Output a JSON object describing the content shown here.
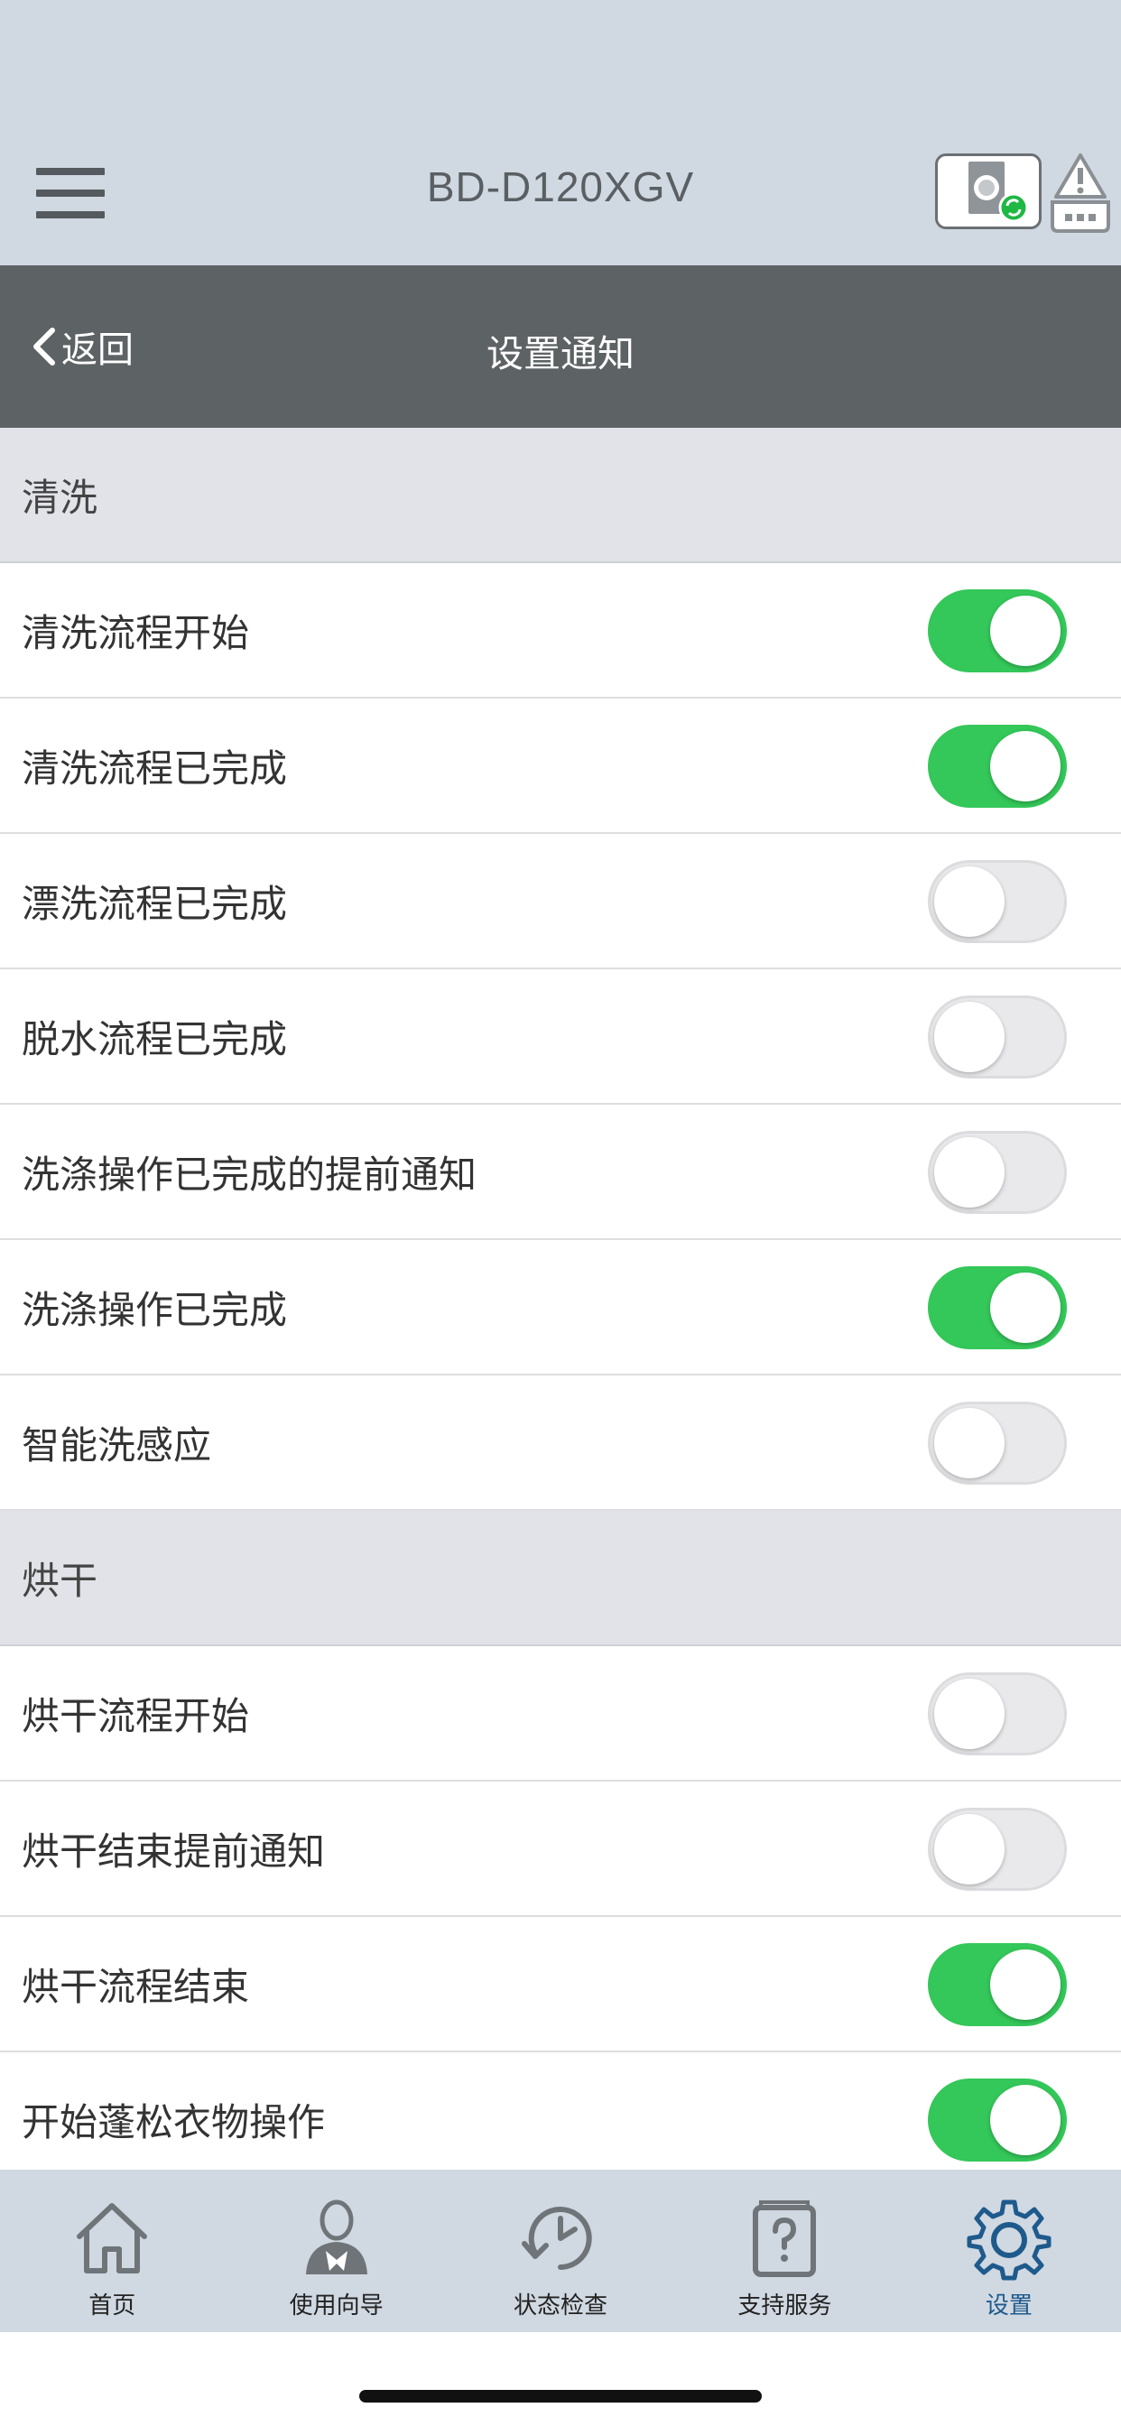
{
  "header": {
    "app_title": "BD-D120XGV",
    "menu_icon": "hamburger-menu-icon",
    "device_icon": "washer-status-icon",
    "alert_icon": "warning-icon"
  },
  "nav": {
    "back_label": "返回",
    "title": "设置通知"
  },
  "sections": [
    {
      "title": "清洗",
      "items": [
        {
          "label": "清洗流程开始",
          "on": true
        },
        {
          "label": "清洗流程已完成",
          "on": true
        },
        {
          "label": "漂洗流程已完成",
          "on": false
        },
        {
          "label": "脱水流程已完成",
          "on": false
        },
        {
          "label": "洗涤操作已完成的提前通知",
          "on": false
        },
        {
          "label": "洗涤操作已完成",
          "on": true
        },
        {
          "label": "智能洗感应",
          "on": false
        }
      ]
    },
    {
      "title": "烘干",
      "items": [
        {
          "label": "烘干流程开始",
          "on": false
        },
        {
          "label": "烘干结束提前通知",
          "on": false
        },
        {
          "label": "烘干流程结束",
          "on": true
        },
        {
          "label": "开始蓬松衣物操作",
          "on": true
        }
      ]
    }
  ],
  "tabs": [
    {
      "label": "首页",
      "icon": "home-icon",
      "active": false
    },
    {
      "label": "使用向导",
      "icon": "guide-person-icon",
      "active": false
    },
    {
      "label": "状态检查",
      "icon": "clock-refresh-icon",
      "active": false
    },
    {
      "label": "支持服务",
      "icon": "help-book-icon",
      "active": false
    },
    {
      "label": "设置",
      "icon": "gear-icon",
      "active": true
    }
  ],
  "colors": {
    "toggle_on": "#34c759",
    "header_bg": "#d0d8e1",
    "nav_bg": "#5d6265",
    "active_tab": "#1e5a8c"
  }
}
